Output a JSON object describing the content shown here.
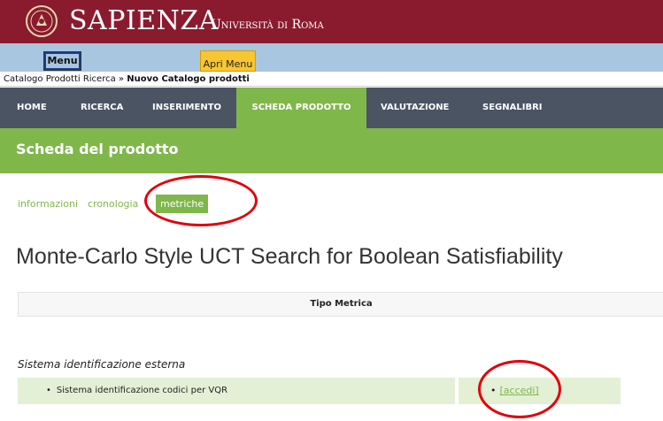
{
  "header": {
    "brand": "SAPIENZA",
    "subtitle": "Università di Roma"
  },
  "menubar": {
    "menu_label": "Menu",
    "apri_label": "Apri Menu"
  },
  "breadcrumb": {
    "parent": "Catalogo Prodotti Ricerca",
    "separator": "»",
    "current": "Nuovo Catalogo prodotti"
  },
  "nav": {
    "items": [
      "HOME",
      "RICERCA",
      "INSERIMENTO",
      "SCHEDA PRODOTTO",
      "VALUTAZIONE",
      "SEGNALIBRI"
    ],
    "active_index": 3
  },
  "page": {
    "section_title": "Scheda del prodotto"
  },
  "tabs": {
    "items": [
      "informazioni",
      "cronologia",
      "metriche"
    ],
    "active_index": 2
  },
  "product": {
    "title": "Monte-Carlo Style UCT Search for Boolean Satisfiability"
  },
  "metrics_table": {
    "header": "Tipo Metrica",
    "section_label": "Sistema identificazione esterna",
    "row_label": "Sistema identificazione codici per VQR",
    "row_link": "[accedi]"
  },
  "colors": {
    "banner": "#8a1b2e",
    "menubar": "#a9c6e0",
    "nav": "#4a5463",
    "accent_green": "#7fb74b",
    "row_green": "#e3f0d6",
    "highlight_ring": "#e0000b"
  },
  "icons": {
    "crest": "sapienza-crest-icon"
  }
}
